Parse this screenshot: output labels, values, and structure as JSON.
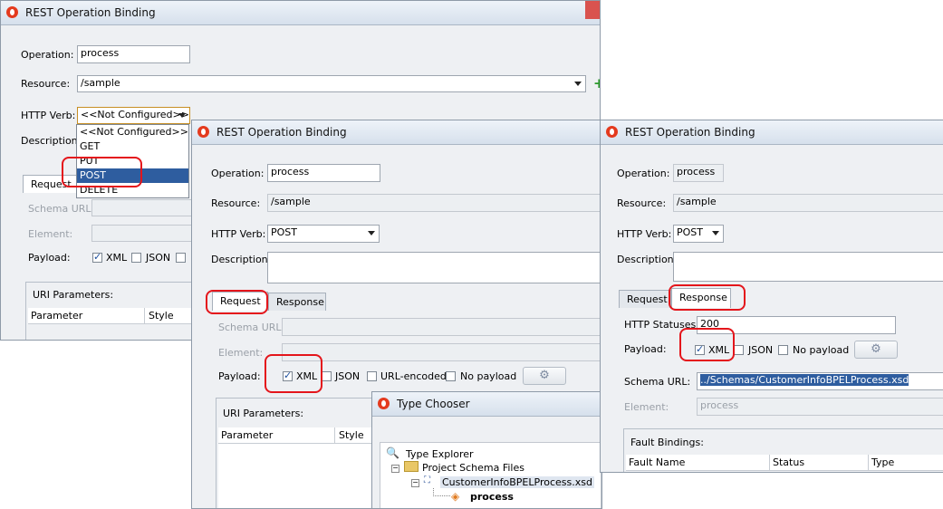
{
  "window1": {
    "title": "REST Operation Binding",
    "operation_label": "Operation:",
    "operation_value": "process",
    "resource_label": "Resource:",
    "resource_value": "/sample",
    "verb_label": "HTTP Verb:",
    "verb_value": "<<Not Configured>>",
    "description_label": "Description:",
    "verb_options": [
      "<<Not Configured>>",
      "GET",
      "PUT",
      "POST",
      "DELETE"
    ],
    "selected_option": "POST",
    "tab_request": "Request",
    "schema_url_label": "Schema URL:",
    "element_label": "Element:",
    "payload_label": "Payload:",
    "xml_label": "XML",
    "json_label": "JSON",
    "uri_params_label": "URI Parameters:",
    "col_parameter": "Parameter",
    "col_style": "Style"
  },
  "window2": {
    "title": "REST Operation Binding",
    "operation_label": "Operation:",
    "operation_value": "process",
    "resource_label": "Resource:",
    "resource_value": "/sample",
    "verb_label": "HTTP Verb:",
    "verb_value": "POST",
    "description_label": "Description:",
    "tab_request": "Request",
    "tab_response": "Response",
    "schema_url_label": "Schema URL:",
    "element_label": "Element:",
    "payload_label": "Payload:",
    "xml_label": "XML",
    "json_label": "JSON",
    "url_encoded_label": "URL-encoded",
    "no_payload_label": "No payload",
    "uri_params_label": "URI Parameters:",
    "col_parameter": "Parameter",
    "col_style": "Style"
  },
  "window3": {
    "title": "REST Operation Binding",
    "operation_label": "Operation:",
    "operation_value": "process",
    "resource_label": "Resource:",
    "resource_value": "/sample",
    "verb_label": "HTTP Verb:",
    "verb_value": "POST",
    "description_label": "Description:",
    "tab_request": "Request",
    "tab_response": "Response",
    "http_statuses_label": "HTTP Statuses:",
    "http_statuses_value": "200",
    "payload_label": "Payload:",
    "xml_label": "XML",
    "json_label": "JSON",
    "no_payload_label": "No payload",
    "schema_url_label": "Schema URL:",
    "schema_url_value": "../Schemas/CustomerInfoBPELProcess.xsd",
    "element_label": "Element:",
    "element_value": "process",
    "fault_bindings_label": "Fault Bindings:",
    "col_fault_name": "Fault Name",
    "col_status": "Status",
    "col_type": "Type"
  },
  "type_chooser": {
    "title": "Type Chooser",
    "root": "Type Explorer",
    "folder": "Project Schema Files",
    "file": "CustomerInfoBPELProcess.xsd",
    "element": "process"
  },
  "colors": {
    "highlight": "#e4151b",
    "selection": "#2e5d9f"
  }
}
